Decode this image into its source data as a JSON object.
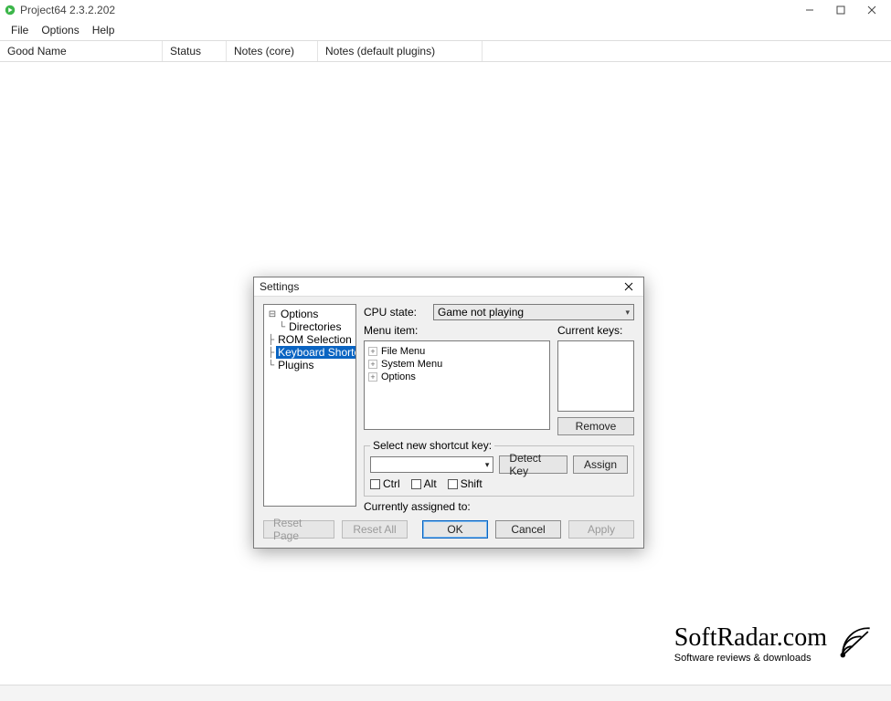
{
  "window": {
    "title": "Project64 2.3.2.202",
    "menu": {
      "file": "File",
      "options": "Options",
      "help": "Help"
    },
    "columns": {
      "c0": "Good Name",
      "c1": "Status",
      "c2": "Notes (core)",
      "c3": "Notes (default plugins)"
    }
  },
  "dialog": {
    "title": "Settings",
    "tree": {
      "options": "Options",
      "directories": "Directories",
      "rom_selection": "ROM Selection",
      "keyboard_shortcuts": "Keyboard Shortcuts",
      "plugins": "Plugins"
    },
    "cpu_state_label": "CPU state:",
    "cpu_state_value": "Game not playing",
    "menu_item_label": "Menu item:",
    "current_keys_label": "Current keys:",
    "menu_items": {
      "file_menu": "File Menu",
      "system_menu": "System Menu",
      "options": "Options"
    },
    "remove": "Remove",
    "group_legend": "Select new shortcut key:",
    "detect_key": "Detect Key",
    "assign": "Assign",
    "ctrl": "Ctrl",
    "alt": "Alt",
    "shift": "Shift",
    "currently_assigned": "Currently assigned to:",
    "reset_page": "Reset Page",
    "reset_all": "Reset All",
    "ok": "OK",
    "cancel": "Cancel",
    "apply": "Apply"
  },
  "watermark": {
    "domain": "SoftRadar.com",
    "tagline": "Software reviews & downloads"
  }
}
